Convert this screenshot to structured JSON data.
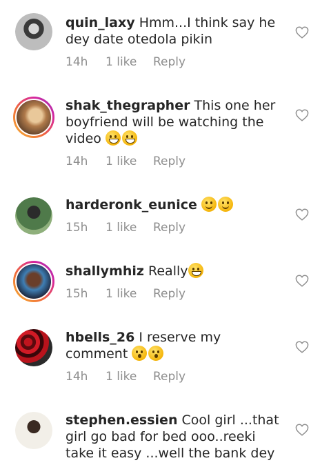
{
  "comments": [
    {
      "username": "quin_laxy",
      "text": "Hmm...I think say he dey date otedola pikin",
      "time": "14h",
      "likes": "1 like",
      "reply": "Reply",
      "emoji": []
    },
    {
      "username": "shak_thegrapher",
      "text": "This one her boyfriend will be watching the video",
      "time": "14h",
      "likes": "1 like",
      "reply": "Reply",
      "emoji": [
        "grin",
        "grin"
      ]
    },
    {
      "username": "harderonk_eunice",
      "text": "",
      "time": "15h",
      "likes": "1 like",
      "reply": "Reply",
      "emoji": [
        "smile",
        "smile"
      ]
    },
    {
      "username": "shallymhiz",
      "text": "Really",
      "time": "15h",
      "likes": "1 like",
      "reply": "Reply",
      "emoji": [
        "grin"
      ]
    },
    {
      "username": "hbells_26",
      "text": "I reserve my comment",
      "time": "14h",
      "likes": "1 like",
      "reply": "Reply",
      "emoji": [
        "o",
        "o"
      ]
    },
    {
      "username": "stephen.essien",
      "text": "Cool girl ...that girl go bad for bed ooo..reeki take it easy ...well the bank dey ....",
      "time": "",
      "likes": "",
      "reply": "",
      "emoji": []
    }
  ],
  "icons": {
    "like": "heart-outline-icon"
  }
}
